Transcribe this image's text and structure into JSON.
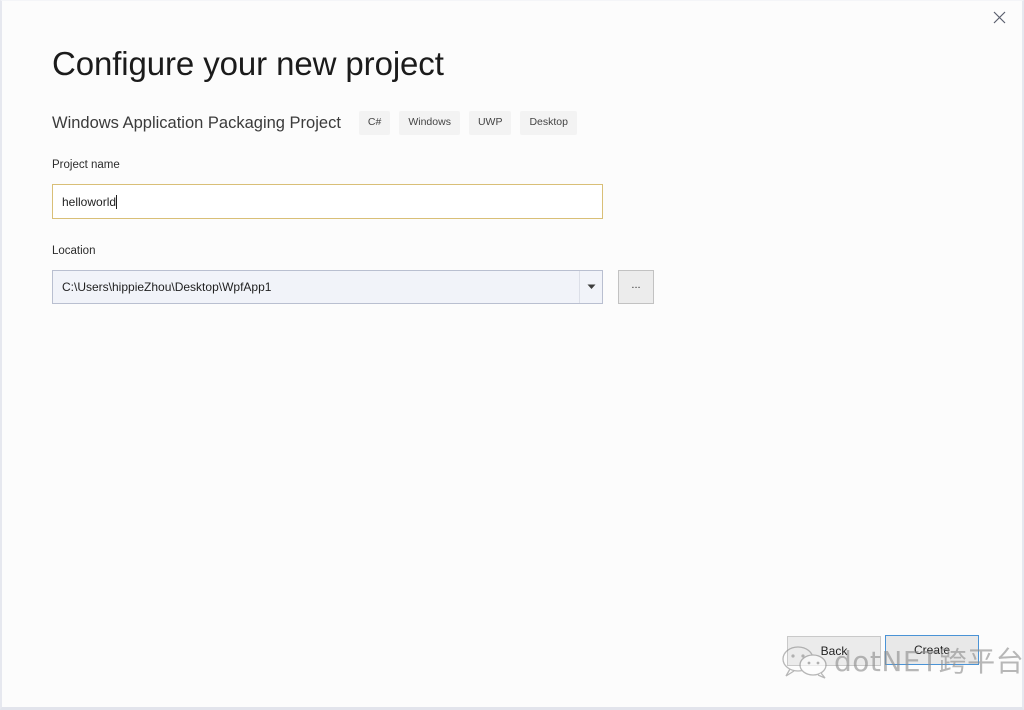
{
  "dialog": {
    "title": "Configure your new project",
    "subtitle": "Windows Application Packaging Project",
    "close_icon": "close-icon",
    "tags": [
      "C#",
      "Windows",
      "UWP",
      "Desktop"
    ]
  },
  "form": {
    "project_name": {
      "label": "Project name",
      "value": "helloworld",
      "placeholder": ""
    },
    "location": {
      "label": "Location",
      "value": "C:\\Users\\hippieZhou\\Desktop\\WpfApp1",
      "dropdown_icon": "chevron-down-icon"
    },
    "browse_button": {
      "label": "...",
      "name": "browse-button"
    }
  },
  "footer": {
    "back_label": "Back",
    "create_label": "Create"
  },
  "watermark": {
    "text": "dotNET跨平台",
    "icon": "wechat-icon"
  },
  "colors": {
    "accent": "#4a93d6",
    "focus_border": "#d9bf77",
    "chip_bg": "#f3f3f3",
    "combo_bg": "#f1f3f9"
  }
}
